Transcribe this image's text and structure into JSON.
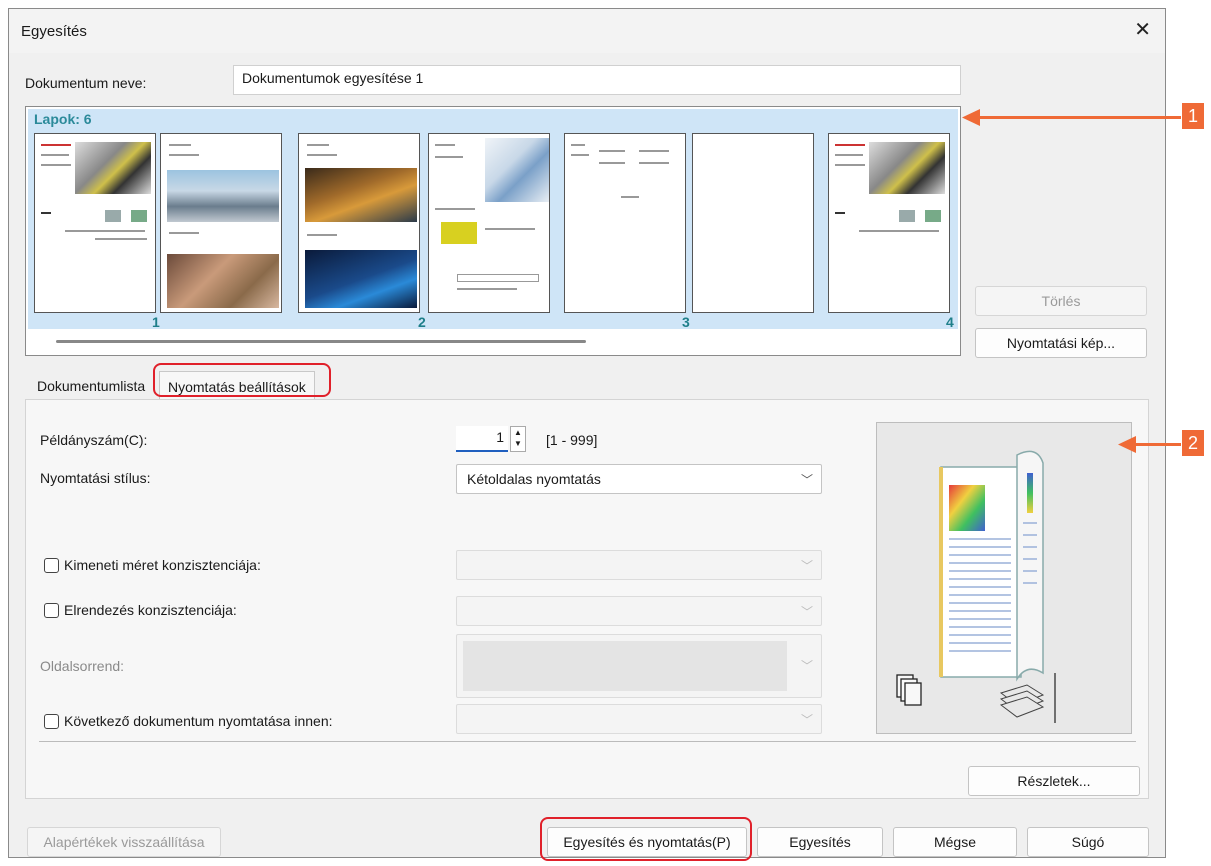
{
  "dialog": {
    "title": "Egyesítés",
    "close_glyph": "✕"
  },
  "document_name": {
    "label": "Dokumentum neve:",
    "value": "Dokumentumok egyesítése 1"
  },
  "pages": {
    "title": "Lapok: 6",
    "numbers": [
      "1",
      "2",
      "3",
      "4"
    ]
  },
  "side_buttons": {
    "delete": "Törlés",
    "print_preview": "Nyomtatási kép..."
  },
  "tabs": {
    "document_list": "Dokumentumlista",
    "print_settings": "Nyomtatás beállítások"
  },
  "settings": {
    "copies_label": "Példányszám(C):",
    "copies_value": "1",
    "copies_range": "[1 - 999]",
    "style_label": "Nyomtatási stílus:",
    "style_value": "Kétoldalas nyomtatás",
    "output_size_label": "Kimeneti méret konzisztenciája:",
    "layout_label": "Elrendezés konzisztenciája:",
    "page_order_label": "Oldalsorrend:",
    "next_doc_label": "Következő dokumentum nyomtatása innen:"
  },
  "buttons": {
    "details": "Részletek...",
    "reset": "Alapértékek visszaállítása",
    "merge_print": "Egyesítés és nyomtatás(P)",
    "merge": "Egyesítés",
    "cancel": "Mégse",
    "help": "Súgó"
  },
  "callouts": {
    "one": "1",
    "two": "2"
  },
  "colors": {
    "accent_highlight": "#e0202a",
    "callout": "#ef6a36",
    "pages_bg": "#cfe5f7",
    "pages_title": "#2b8a9a"
  }
}
